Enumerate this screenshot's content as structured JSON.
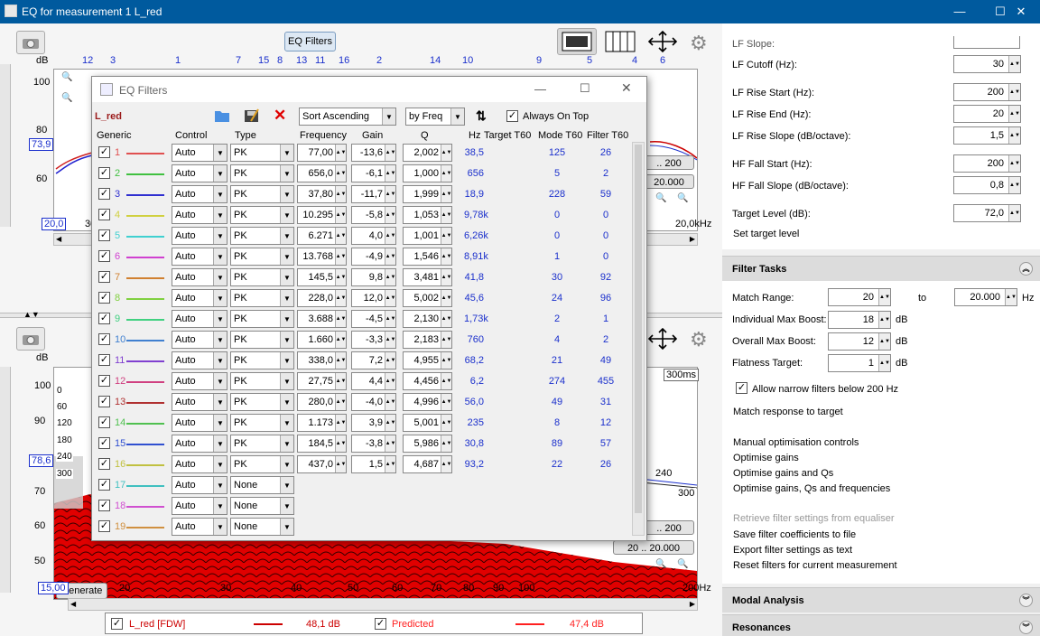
{
  "window": {
    "title": "EQ for measurement 1 L_red",
    "min": "—",
    "max": "☐",
    "close": "✕"
  },
  "top_graph": {
    "eq_button": "EQ Filters",
    "db_label": "dB",
    "x_ticks_top": [
      "12",
      "3",
      "1",
      "7",
      "15",
      "8",
      "13",
      "11",
      "16",
      "2",
      "14",
      "10",
      "9",
      "5",
      "4",
      "6"
    ],
    "y_ticks": [
      "100",
      "80",
      "60"
    ],
    "marker_value": "73,9",
    "x_start": "20,0",
    "x_start_partial": "30",
    "x_end": "20,0kHz",
    "range_btn_1": ".. 200",
    "range_btn_2": "20.000"
  },
  "bottom_graph": {
    "db_label": "dB",
    "y_ticks": [
      "100",
      "90",
      "80",
      "70",
      "60",
      "50"
    ],
    "marker_value": "78,6",
    "time_labels": [
      "0",
      "60",
      "120",
      "180",
      "240",
      "300"
    ],
    "time_right": [
      "300ms",
      "240",
      "300"
    ],
    "range_btn_1": ".. 200",
    "range_btn_2": "20 .. 20.000",
    "generate_label": "Generate",
    "x_start": "15,00",
    "x_ticks": [
      "20",
      "30",
      "40",
      "50",
      "60",
      "70",
      "80",
      "90",
      "100"
    ],
    "x_end": "200Hz"
  },
  "legend": {
    "items": [
      {
        "label": "L_red [FDW]",
        "value": "48,1 dB",
        "color": "#cc0000"
      },
      {
        "label": "Predicted",
        "value": "47,4 dB",
        "color": "#ff2020"
      }
    ]
  },
  "dialog": {
    "title": "EQ Filters",
    "measurement": "L_red",
    "sort_option": "Sort Ascending",
    "sort_by": "by Freq",
    "always_on_top": "Always On Top",
    "headers": [
      "Generic",
      "Control",
      "Type",
      "Frequency",
      "Gain",
      "Q",
      "Hz",
      "Target T60",
      "Mode T60",
      "Filter T60"
    ],
    "filters": [
      {
        "n": "1",
        "color": "#e05050",
        "control": "Auto",
        "type": "PK",
        "freq": "77,00",
        "gain": "-13,6",
        "q": "2,002",
        "hz": "38,5",
        "mode": "125",
        "filt": "26"
      },
      {
        "n": "2",
        "color": "#40c040",
        "control": "Auto",
        "type": "PK",
        "freq": "656,0",
        "gain": "-6,1",
        "q": "1,000",
        "hz": "656",
        "mode": "5",
        "filt": "2"
      },
      {
        "n": "3",
        "color": "#3030d0",
        "control": "Auto",
        "type": "PK",
        "freq": "37,80",
        "gain": "-11,7",
        "q": "1,999",
        "hz": "18,9",
        "mode": "228",
        "filt": "59"
      },
      {
        "n": "4",
        "color": "#d0d040",
        "control": "Auto",
        "type": "PK",
        "freq": "10.295",
        "gain": "-5,8",
        "q": "1,053",
        "hz": "9,78k",
        "mode": "0",
        "filt": "0"
      },
      {
        "n": "5",
        "color": "#40d0d0",
        "control": "Auto",
        "type": "PK",
        "freq": "6.271",
        "gain": "4,0",
        "q": "1,001",
        "hz": "6,26k",
        "mode": "0",
        "filt": "0"
      },
      {
        "n": "6",
        "color": "#d040d0",
        "control": "Auto",
        "type": "PK",
        "freq": "13.768",
        "gain": "-4,9",
        "q": "1,546",
        "hz": "8,91k",
        "mode": "1",
        "filt": "0"
      },
      {
        "n": "7",
        "color": "#d08030",
        "control": "Auto",
        "type": "PK",
        "freq": "145,5",
        "gain": "9,8",
        "q": "3,481",
        "hz": "41,8",
        "mode": "30",
        "filt": "92"
      },
      {
        "n": "8",
        "color": "#80d040",
        "control": "Auto",
        "type": "PK",
        "freq": "228,0",
        "gain": "12,0",
        "q": "5,002",
        "hz": "45,6",
        "mode": "24",
        "filt": "96"
      },
      {
        "n": "9",
        "color": "#40d080",
        "control": "Auto",
        "type": "PK",
        "freq": "3.688",
        "gain": "-4,5",
        "q": "2,130",
        "hz": "1,73k",
        "mode": "2",
        "filt": "1"
      },
      {
        "n": "10",
        "color": "#4080d0",
        "control": "Auto",
        "type": "PK",
        "freq": "1.660",
        "gain": "-3,3",
        "q": "2,183",
        "hz": "760",
        "mode": "4",
        "filt": "2"
      },
      {
        "n": "11",
        "color": "#8040d0",
        "control": "Auto",
        "type": "PK",
        "freq": "338,0",
        "gain": "7,2",
        "q": "4,955",
        "hz": "68,2",
        "mode": "21",
        "filt": "49"
      },
      {
        "n": "12",
        "color": "#d04080",
        "control": "Auto",
        "type": "PK",
        "freq": "27,75",
        "gain": "4,4",
        "q": "4,456",
        "hz": "6,2",
        "mode": "274",
        "filt": "455"
      },
      {
        "n": "13",
        "color": "#b03030",
        "control": "Auto",
        "type": "PK",
        "freq": "280,0",
        "gain": "-4,0",
        "q": "4,996",
        "hz": "56,0",
        "mode": "49",
        "filt": "31"
      },
      {
        "n": "14",
        "color": "#50c050",
        "control": "Auto",
        "type": "PK",
        "freq": "1.173",
        "gain": "3,9",
        "q": "5,001",
        "hz": "235",
        "mode": "8",
        "filt": "12"
      },
      {
        "n": "15",
        "color": "#3050d0",
        "control": "Auto",
        "type": "PK",
        "freq": "184,5",
        "gain": "-3,8",
        "q": "5,986",
        "hz": "30,8",
        "mode": "89",
        "filt": "57"
      },
      {
        "n": "16",
        "color": "#c0c040",
        "control": "Auto",
        "type": "PK",
        "freq": "437,0",
        "gain": "1,5",
        "q": "4,687",
        "hz": "93,2",
        "mode": "22",
        "filt": "26"
      },
      {
        "n": "17",
        "color": "#40c0c0",
        "control": "Auto",
        "type": "None",
        "freq": "",
        "gain": "",
        "q": "",
        "hz": "",
        "mode": "",
        "filt": ""
      },
      {
        "n": "18",
        "color": "#d050d0",
        "control": "Auto",
        "type": "None",
        "freq": "",
        "gain": "",
        "q": "",
        "hz": "",
        "mode": "",
        "filt": ""
      },
      {
        "n": "19",
        "color": "#d09040",
        "control": "Auto",
        "type": "None",
        "freq": "",
        "gain": "",
        "q": "",
        "hz": "",
        "mode": "",
        "filt": ""
      }
    ]
  },
  "right_panel": {
    "cut_label": "LF Slope:",
    "fields": [
      {
        "label": "LF Cutoff (Hz):",
        "value": "30"
      },
      {
        "label": "LF Rise Start (Hz):",
        "value": "200"
      },
      {
        "label": "LF Rise End (Hz):",
        "value": "20"
      },
      {
        "label": "LF Rise Slope (dB/octave):",
        "value": "1,5"
      },
      {
        "label": "HF Fall Start (Hz):",
        "value": "200"
      },
      {
        "label": "HF Fall Slope (dB/octave):",
        "value": "0,8"
      },
      {
        "label": "Target Level (dB):",
        "value": "72,0"
      }
    ],
    "set_target": "Set target level",
    "filter_tasks": {
      "title": "Filter Tasks",
      "match_range_label": "Match Range:",
      "match_from": "20",
      "to_label": "to",
      "match_to": "20.000",
      "hz": "Hz",
      "ind_label": "Individual Max Boost:",
      "ind_value": "18",
      "ovr_label": "Overall Max Boost:",
      "ovr_value": "12",
      "flat_label": "Flatness Target:",
      "flat_value": "1",
      "db": "dB",
      "allow_narrow": "Allow narrow filters below 200 Hz",
      "match_response": "Match response to target",
      "manual": "Manual optimisation controls",
      "opt_gains": "Optimise gains",
      "opt_gains_qs": "Optimise gains and Qs",
      "opt_all": "Optimise gains, Qs and frequencies",
      "retrieve": "Retrieve filter settings from equaliser",
      "save_coeff": "Save filter coefficients to file",
      "export": "Export filter settings as text",
      "reset": "Reset filters for current measurement"
    },
    "modal": "Modal Analysis",
    "resonances": "Resonances"
  }
}
